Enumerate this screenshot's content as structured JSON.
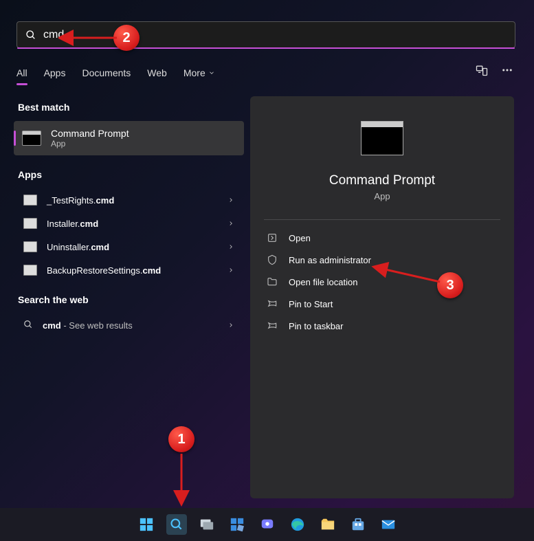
{
  "search": {
    "value": "cmd"
  },
  "tabs": {
    "all": "All",
    "apps": "Apps",
    "documents": "Documents",
    "web": "Web",
    "more": "More"
  },
  "sections": {
    "best_match": "Best match",
    "apps": "Apps",
    "search_web": "Search the web"
  },
  "best_match": {
    "title": "Command Prompt",
    "subtitle": "App"
  },
  "apps_list": [
    {
      "prefix": "_TestRights.",
      "ext": "cmd"
    },
    {
      "prefix": "Installer.",
      "ext": "cmd"
    },
    {
      "prefix": "Uninstaller.",
      "ext": "cmd"
    },
    {
      "prefix": "BackupRestoreSettings.",
      "ext": "cmd"
    }
  ],
  "web_result": {
    "term": "cmd",
    "suffix": " - See web results"
  },
  "preview": {
    "title": "Command Prompt",
    "subtitle": "App",
    "actions": {
      "open": "Open",
      "run_admin": "Run as administrator",
      "open_loc": "Open file location",
      "pin_start": "Pin to Start",
      "pin_taskbar": "Pin to taskbar"
    }
  },
  "annotations": {
    "b1": "1",
    "b2": "2",
    "b3": "3"
  }
}
